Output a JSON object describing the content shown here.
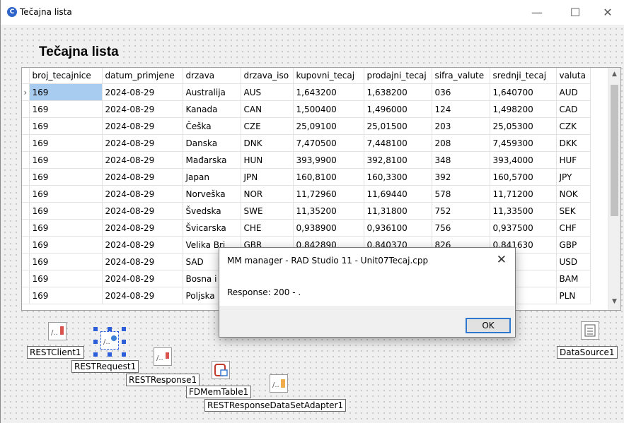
{
  "window": {
    "title": "Tečajna lista",
    "minimize_glyph": "—",
    "maximize_glyph": "☐",
    "close_glyph": "✕"
  },
  "form_heading": "Tečajna lista",
  "grid": {
    "indicator": "›",
    "columns": [
      "broj_tecajnice",
      "datum_primjene",
      "drzava",
      "drzava_iso",
      "kupovni_tecaj",
      "prodajni_tecaj",
      "sifra_valute",
      "srednji_tecaj",
      "valuta"
    ],
    "rows": [
      [
        "169",
        "2024-08-29",
        "Australija",
        "AUS",
        "1,643200",
        "1,638200",
        "036",
        "1,640700",
        "AUD"
      ],
      [
        "169",
        "2024-08-29",
        "Kanada",
        "CAN",
        "1,500400",
        "1,496000",
        "124",
        "1,498200",
        "CAD"
      ],
      [
        "169",
        "2024-08-29",
        "Češka",
        "CZE",
        "25,09100",
        "25,01500",
        "203",
        "25,05300",
        "CZK"
      ],
      [
        "169",
        "2024-08-29",
        "Danska",
        "DNK",
        "7,470500",
        "7,448100",
        "208",
        "7,459300",
        "DKK"
      ],
      [
        "169",
        "2024-08-29",
        "Mađarska",
        "HUN",
        "393,9900",
        "392,8100",
        "348",
        "393,4000",
        "HUF"
      ],
      [
        "169",
        "2024-08-29",
        "Japan",
        "JPN",
        "160,8100",
        "160,3300",
        "392",
        "160,5700",
        "JPY"
      ],
      [
        "169",
        "2024-08-29",
        "Norveška",
        "NOR",
        "11,72960",
        "11,69440",
        "578",
        "11,71200",
        "NOK"
      ],
      [
        "169",
        "2024-08-29",
        "Švedska",
        "SWE",
        "11,35200",
        "11,31800",
        "752",
        "11,33500",
        "SEK"
      ],
      [
        "169",
        "2024-08-29",
        "Švicarska",
        "CHE",
        "0,938900",
        "0,936100",
        "756",
        "0,937500",
        "CHF"
      ],
      [
        "169",
        "2024-08-29",
        "Velika Bri",
        "GBR",
        "0,842890",
        "0,840370",
        "826",
        "0,841630",
        "GBP"
      ],
      [
        "169",
        "2024-08-29",
        "SAD",
        "",
        "",
        "",
        "",
        "",
        "USD"
      ],
      [
        "169",
        "2024-08-29",
        "Bosna i",
        "",
        "",
        "",
        "",
        "",
        "BAM"
      ],
      [
        "169",
        "2024-08-29",
        "Poljska",
        "",
        "",
        "",
        "",
        "",
        "PLN"
      ]
    ]
  },
  "components": {
    "rest_client": "RESTClient1",
    "rest_request": "RESTRequest1",
    "rest_response": "RESTResponse1",
    "fd_mem_table": "FDMemTable1",
    "rest_adapter": "RESTResponseDataSetAdapter1",
    "data_source": "DataSource1"
  },
  "dialog": {
    "title": "MM manager - RAD Studio 11 - Unit07Tecaj.cpp",
    "message": "Response: 200 - .",
    "ok_label": "OK",
    "close_glyph": "✕"
  },
  "icons": {
    "app": "rad-studio-app-icon",
    "components": "rest-component-icon"
  }
}
